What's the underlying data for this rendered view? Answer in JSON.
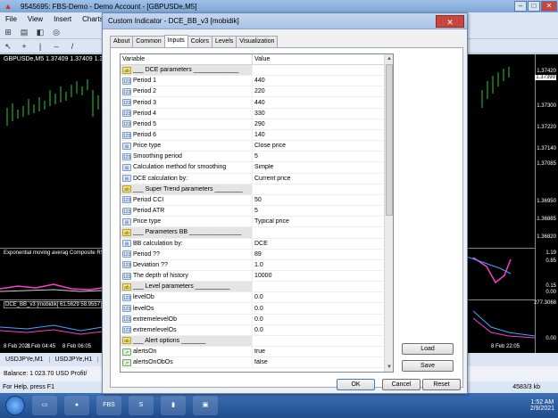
{
  "main_window": {
    "title": "9545695: FBS-Demo - Demo Account - [GBPUSDe,M5]",
    "menu": [
      "File",
      "View",
      "Insert",
      "Charts"
    ],
    "chart_symbol_line": "GBPUSDe,M5  1.37409 1.37409 1.37399",
    "price_labels": [
      "1.37420",
      "1.37399",
      "1.37300",
      "1.37220",
      "1.37140",
      "1.37085",
      "1.36950",
      "1.36885",
      "1.36820"
    ],
    "subwindow1_label": "Exponential moving averag Composite RSI",
    "subwindow1_prices": [
      "1.19",
      "0.85",
      "0.15",
      "0.00"
    ],
    "subwindow2_label": "DCE_BB_v3 [mobidik] 61.5629 58.9557",
    "subwindow2_prices": [
      "277.3068",
      "0.00"
    ],
    "time_labels": [
      "8 Feb 2021",
      "8 Feb 04:45",
      "8 Feb 06:05",
      "8 Feb 22:05"
    ],
    "bottom_tabs": [
      "USDJPYe,M1",
      "USDJPYe,H1"
    ],
    "balance_text": "Balance: 1 023.70 USD  Profit/",
    "status_help": "For Help, press F1",
    "status_traffic": "4583/3 kb"
  },
  "taskbar": {
    "apps": [
      "FBS",
      "S"
    ],
    "time": "1:52 AM",
    "date": "2/9/2021"
  },
  "dialog": {
    "title": "Custom Indicator - DCE_BB_v3 [mobidik]",
    "close_glyph": "✕",
    "tabs": [
      "About",
      "Common",
      "Inputs",
      "Colors",
      "Levels",
      "Visualization"
    ],
    "active_tab": "Inputs",
    "columns": {
      "variable": "Variable",
      "value": "Value"
    },
    "rows": [
      {
        "type": "ab",
        "name": "___ DCE parameters _____________",
        "value": "",
        "group": true
      },
      {
        "type": "num",
        "name": "Period 1",
        "value": "440"
      },
      {
        "type": "num",
        "name": "Period 2",
        "value": "220"
      },
      {
        "type": "num",
        "name": "Period 3",
        "value": "440"
      },
      {
        "type": "num",
        "name": "Period 4",
        "value": "330"
      },
      {
        "type": "num",
        "name": "Period 5",
        "value": "290"
      },
      {
        "type": "num",
        "name": "Period 6",
        "value": "140"
      },
      {
        "type": "enum",
        "name": "Price type",
        "value": "Close price"
      },
      {
        "type": "num",
        "name": "Smoothing period",
        "value": "5"
      },
      {
        "type": "enum",
        "name": "Calculation method for smoothing",
        "value": "Simple"
      },
      {
        "type": "enum",
        "name": "DCE calculation by:",
        "value": "Current price"
      },
      {
        "type": "ab",
        "name": "___ Super Trend parameters ________",
        "value": "",
        "group": true
      },
      {
        "type": "num",
        "name": "Period CCI",
        "value": "50"
      },
      {
        "type": "num",
        "name": "Period ATR",
        "value": "5"
      },
      {
        "type": "enum",
        "name": "Price type",
        "value": "Typical price"
      },
      {
        "type": "ab",
        "name": "___ Parameters BB _______________",
        "value": "",
        "group": true
      },
      {
        "type": "enum",
        "name": "BB calculation by:",
        "value": "DCE"
      },
      {
        "type": "num",
        "name": "Period ??",
        "value": "89"
      },
      {
        "type": "num",
        "name": "Deviation ??",
        "value": "1.0"
      },
      {
        "type": "num",
        "name": "The depth of history",
        "value": "10000"
      },
      {
        "type": "ab",
        "name": "___ Level parameters __________",
        "value": "",
        "group": true
      },
      {
        "type": "num",
        "name": "levelOb",
        "value": "0.0"
      },
      {
        "type": "num",
        "name": "levelOs",
        "value": "0.0"
      },
      {
        "type": "num",
        "name": "extremelevelOb",
        "value": "0.0"
      },
      {
        "type": "num",
        "name": "extremelevelOs",
        "value": "0.0"
      },
      {
        "type": "ab",
        "name": "___ Alert options _______",
        "value": "",
        "group": true
      },
      {
        "type": "bool",
        "name": "alertsOn",
        "value": "true"
      },
      {
        "type": "bool",
        "name": "alertsOnObOs",
        "value": "false"
      }
    ],
    "icon_text": {
      "ab": "ab",
      "num": "123",
      "enum": "⊞",
      "bool": "↗"
    },
    "buttons": {
      "load": "Load",
      "save": "Save",
      "ok": "OK",
      "cancel": "Cancel",
      "reset": "Reset"
    }
  }
}
